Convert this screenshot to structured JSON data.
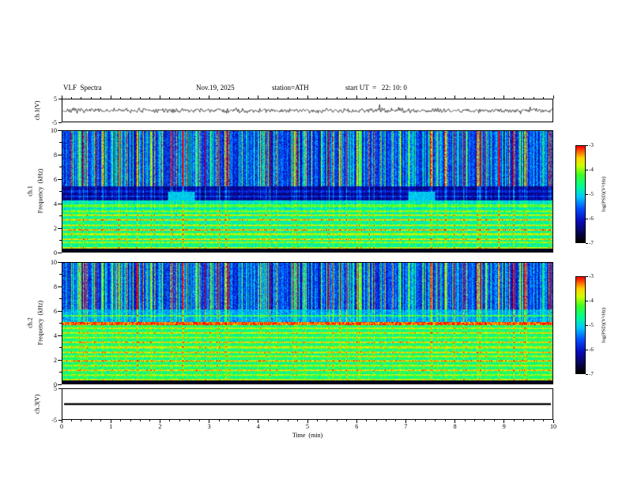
{
  "header": {
    "title": "VLF  Spectra",
    "date": "Nov.19, 2025",
    "station": "station=ATH",
    "start_ut": "start UT  =   22: 10: 0"
  },
  "axes": {
    "time": {
      "label": "Time  (min)",
      "min": 0,
      "max": 10,
      "major_ticks": [
        0,
        1,
        2,
        3,
        4,
        5,
        6,
        7,
        8,
        9,
        10
      ],
      "minor_step": 0.2
    },
    "freq": {
      "label": "Frequency  (kHz)",
      "min": 0,
      "max": 10,
      "major_ticks": [
        10,
        8,
        6,
        4,
        2,
        0
      ],
      "minor_ticks": [
        9,
        7,
        5,
        3,
        1
      ]
    },
    "voltage": {
      "min": -5,
      "max": 5,
      "tick_labels": [
        "5",
        "-5"
      ]
    }
  },
  "panels": {
    "ch1_wave": {
      "ylabel": "ch.1(V)"
    },
    "ch1_spec": {
      "ylabel_line1": "ch.1",
      "ylabel_line2": "Frequency  (kHz)"
    },
    "ch2_spec": {
      "ylabel_line1": "ch.2",
      "ylabel_line2": "Frequency  (kHz)"
    },
    "ch3_wave": {
      "ylabel": "ch.3(V)"
    }
  },
  "colorbar": {
    "label": "log(PSD)(V²/Hz)",
    "min": -7,
    "max": -3,
    "ticks": [
      "-3",
      "-4",
      "-5",
      "-6",
      "-7"
    ]
  },
  "chart_data": [
    {
      "type": "line",
      "panel": "ch1_waveform",
      "series": "ch.1 voltage",
      "xlim": [
        0,
        10
      ],
      "ylim": [
        -5,
        5
      ],
      "character": "zero-mean broadband noise, mostly within ±1.5 V, intermittent spikes to ±3 V",
      "rms": 0.8,
      "spike_amp": 3,
      "seed": 7
    },
    {
      "type": "heatmap",
      "panel": "ch1_spectrogram",
      "xlabel": "Time (min)",
      "ylabel": "ch.1 Frequency (kHz)",
      "xlim": [
        0,
        10
      ],
      "ylim": [
        0,
        10
      ],
      "clim": [
        -7,
        -3
      ],
      "colormap": "black-blue-cyan-green-yellow-red",
      "seed": 11,
      "bands": [
        {
          "f": [
            0,
            0.25
          ],
          "level": -6.85,
          "noise": 0.12
        },
        {
          "f": [
            0.25,
            3.55
          ],
          "level": -4.75,
          "noise": 0.4
        },
        {
          "f": [
            3.55,
            4.25
          ],
          "level": -5.0,
          "noise": 0.35
        },
        {
          "f": [
            4.25,
            5.4
          ],
          "level": -6.45,
          "noise": 0.3
        },
        {
          "f": [
            5.4,
            10
          ],
          "level": -6.05,
          "noise": 0.4
        }
      ],
      "lines": [
        {
          "f": 0.3,
          "level": -3.9
        },
        {
          "f": 0.75,
          "level": -4.1
        },
        {
          "f": 1.05,
          "level": -3.8
        },
        {
          "f": 1.45,
          "level": -4.0
        },
        {
          "f": 1.8,
          "level": -3.6
        },
        {
          "f": 2.2,
          "level": -3.9
        },
        {
          "f": 2.65,
          "level": -3.7
        },
        {
          "f": 3.05,
          "level": -3.9
        },
        {
          "f": 3.35,
          "level": -4.1
        },
        {
          "f": 3.8,
          "level": -4.3,
          "w": 0.13
        },
        {
          "f": 4.6,
          "level": -6.0
        },
        {
          "f": 5.0,
          "level": -6.1
        }
      ],
      "patches": [
        {
          "t": [
            2.15,
            2.7
          ],
          "f": [
            4.3,
            5.0
          ],
          "level": -5.1
        },
        {
          "t": [
            7.05,
            7.6
          ],
          "f": [
            4.3,
            5.0
          ],
          "level": -5.1
        }
      ],
      "sferics": {
        "description": "dense vertical impulsive streaks (sferics) strongest above ~5.4 kHz",
        "profile": [
          {
            "f": [
              5.4,
              10
            ],
            "gain": 1.0
          },
          {
            "f": [
              4.25,
              5.4
            ],
            "gain": 0.3
          },
          {
            "f": [
              0.25,
              4.25
            ],
            "gain": 0.18
          },
          {
            "f": [
              0,
              0.25
            ],
            "gain": 0.0
          }
        ],
        "density": 0.6,
        "max_boost": 2.6
      }
    },
    {
      "type": "heatmap",
      "panel": "ch2_spectrogram",
      "xlabel": "Time (min)",
      "ylabel": "ch.2 Frequency (kHz)",
      "xlim": [
        0,
        10
      ],
      "ylim": [
        0,
        10
      ],
      "clim": [
        -7,
        -3
      ],
      "colormap": "black-blue-cyan-green-yellow-red",
      "seed": 23,
      "bands": [
        {
          "f": [
            0,
            0.25
          ],
          "level": -6.85,
          "noise": 0.12
        },
        {
          "f": [
            0.25,
            5.1
          ],
          "level": -4.6,
          "noise": 0.42
        },
        {
          "f": [
            5.1,
            6.1
          ],
          "level": -5.4,
          "noise": 0.35
        },
        {
          "f": [
            6.1,
            10
          ],
          "level": -6.05,
          "noise": 0.4
        }
      ],
      "lines": [
        {
          "f": 0.3,
          "level": -3.9
        },
        {
          "f": 0.7,
          "level": -4.0
        },
        {
          "f": 1.1,
          "level": -3.7
        },
        {
          "f": 1.5,
          "level": -3.9
        },
        {
          "f": 1.85,
          "level": -3.6
        },
        {
          "f": 2.25,
          "level": -3.9
        },
        {
          "f": 2.6,
          "level": -3.7
        },
        {
          "f": 3.0,
          "level": -3.9
        },
        {
          "f": 3.4,
          "level": -3.7
        },
        {
          "f": 3.8,
          "level": -4.0
        },
        {
          "f": 4.2,
          "level": -3.8
        },
        {
          "f": 4.6,
          "level": -3.9
        },
        {
          "f": 4.95,
          "level": -3.3,
          "w": 0.13
        },
        {
          "f": 5.6,
          "level": -4.6
        }
      ],
      "patches": [],
      "sferics": {
        "description": "dense vertical impulsive streaks (sferics) strongest above ~6 kHz",
        "profile": [
          {
            "f": [
              6.1,
              10
            ],
            "gain": 1.0
          },
          {
            "f": [
              5.1,
              6.1
            ],
            "gain": 0.4
          },
          {
            "f": [
              0.25,
              5.1
            ],
            "gain": 0.15
          },
          {
            "f": [
              0,
              0.25
            ],
            "gain": 0.0
          }
        ],
        "density": 0.6,
        "max_boost": 2.6
      }
    },
    {
      "type": "line",
      "panel": "ch3_waveform",
      "series": "ch.3 voltage",
      "xlim": [
        0,
        10
      ],
      "ylim": [
        -5,
        5
      ],
      "constant": 0,
      "character": "flat zero line (no signal), drawn thick",
      "linewidth": 2.5
    }
  ]
}
